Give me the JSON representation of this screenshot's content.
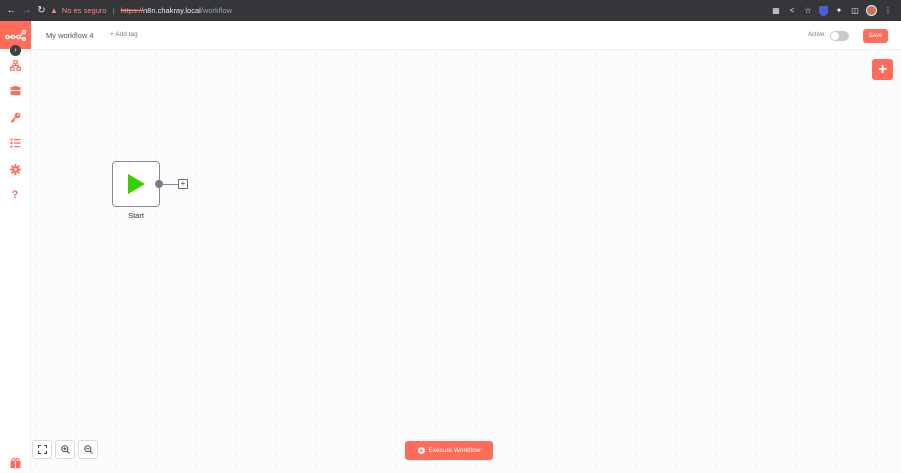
{
  "browser": {
    "security_text": "No es seguro",
    "url_scheme": "https://",
    "url_host": "n8n.chakray.local",
    "url_path": "/workflow"
  },
  "header": {
    "workflow_name": "My workflow 4",
    "add_tag_label": "+ Add tag",
    "active_label": "Active:",
    "save_label": "Save"
  },
  "node": {
    "label": "Start"
  },
  "canvas": {
    "execute_label": "Execute Workflow"
  },
  "colors": {
    "accent": "#ff6d5a",
    "start_play": "#34d000"
  }
}
